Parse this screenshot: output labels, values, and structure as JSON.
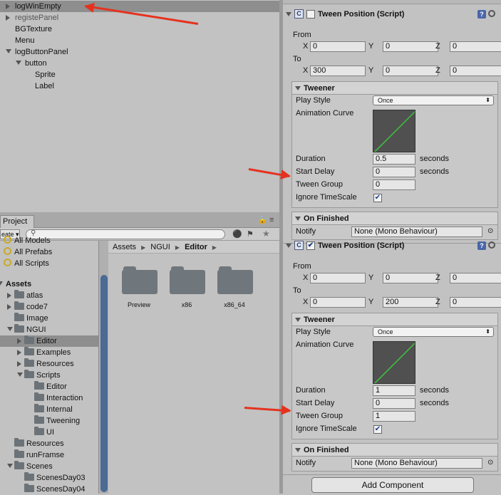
{
  "hierarchy": {
    "items": [
      {
        "label": "logWinEmpty",
        "indent": 1,
        "expander": "right",
        "selected": true
      },
      {
        "label": "registePanel",
        "indent": 1,
        "expander": "right",
        "selected": false,
        "dim": true
      },
      {
        "label": "BGTexture",
        "indent": 1,
        "expander": "none",
        "selected": false
      },
      {
        "label": "Menu",
        "indent": 1,
        "expander": "none",
        "selected": false
      },
      {
        "label": "logButtonPanel",
        "indent": 1,
        "expander": "down",
        "selected": false
      },
      {
        "label": "button",
        "indent": 2,
        "expander": "down",
        "selected": false
      },
      {
        "label": "Sprite",
        "indent": 3,
        "expander": "none",
        "selected": false
      },
      {
        "label": "Label",
        "indent": 3,
        "expander": "none",
        "selected": false
      }
    ]
  },
  "project": {
    "tab_label": "Project",
    "create_label": "eate",
    "favorites": [
      "All Models",
      "All Prefabs",
      "All Scripts"
    ],
    "tree": [
      {
        "label": "Assets",
        "indent": 0,
        "bold": true,
        "expander": "down",
        "folder": false
      },
      {
        "label": "atlas",
        "indent": 1,
        "expander": "right",
        "folder": true
      },
      {
        "label": "code7",
        "indent": 1,
        "expander": "right",
        "folder": true
      },
      {
        "label": "Image",
        "indent": 1,
        "expander": "none",
        "folder": true
      },
      {
        "label": "NGUI",
        "indent": 1,
        "expander": "down",
        "folder": true
      },
      {
        "label": "Editor",
        "indent": 2,
        "expander": "right",
        "folder": true,
        "selected": true
      },
      {
        "label": "Examples",
        "indent": 2,
        "expander": "right",
        "folder": true
      },
      {
        "label": "Resources",
        "indent": 2,
        "expander": "right",
        "folder": true
      },
      {
        "label": "Scripts",
        "indent": 2,
        "expander": "down",
        "folder": true
      },
      {
        "label": "Editor",
        "indent": 3,
        "expander": "none",
        "folder": true
      },
      {
        "label": "Interaction",
        "indent": 3,
        "expander": "none",
        "folder": true
      },
      {
        "label": "Internal",
        "indent": 3,
        "expander": "none",
        "folder": true
      },
      {
        "label": "Tweening",
        "indent": 3,
        "expander": "none",
        "folder": true
      },
      {
        "label": "UI",
        "indent": 3,
        "expander": "none",
        "folder": true
      },
      {
        "label": "Resources",
        "indent": 1,
        "expander": "none",
        "folder": true
      },
      {
        "label": "runFramse",
        "indent": 1,
        "expander": "none",
        "folder": true
      },
      {
        "label": "Scenes",
        "indent": 1,
        "expander": "down",
        "folder": true
      },
      {
        "label": "ScenesDay03",
        "indent": 2,
        "expander": "none",
        "folder": true
      },
      {
        "label": "ScenesDay04",
        "indent": 2,
        "expander": "none",
        "folder": true
      }
    ],
    "breadcrumb": [
      "Assets",
      "NGUI",
      "Editor"
    ],
    "folders": [
      "Preview",
      "x86",
      "x86_64"
    ]
  },
  "inspector": {
    "components": [
      {
        "title": "Tween Position (Script)",
        "enabled": false,
        "from_label": "From",
        "to_label": "To",
        "from": {
          "x": "0",
          "y": "0",
          "z": "0"
        },
        "to": {
          "x": "300",
          "y": "0",
          "z": "0"
        },
        "tweener_label": "Tweener",
        "play_style_label": "Play Style",
        "play_style": "Once",
        "curve_label": "Animation Curve",
        "duration_label": "Duration",
        "duration": "0.5",
        "start_delay_label": "Start Delay",
        "start_delay": "0",
        "seconds": "seconds",
        "tween_group_label": "Tween Group",
        "tween_group": "0",
        "ignore_ts_label": "Ignore TimeScale",
        "ignore_ts": true,
        "on_finished_label": "On Finished",
        "notify_label": "Notify",
        "notify": "None (Mono Behaviour)"
      },
      {
        "title": "Tween Position (Script)",
        "enabled": true,
        "from_label": "From",
        "to_label": "To",
        "from": {
          "x": "0",
          "y": "0",
          "z": "0"
        },
        "to": {
          "x": "0",
          "y": "200",
          "z": "0"
        },
        "tweener_label": "Tweener",
        "play_style_label": "Play Style",
        "play_style": "Once",
        "curve_label": "Animation Curve",
        "duration_label": "Duration",
        "duration": "1",
        "start_delay_label": "Start Delay",
        "start_delay": "0",
        "seconds": "seconds",
        "tween_group_label": "Tween Group",
        "tween_group": "1",
        "ignore_ts_label": "Ignore TimeScale",
        "ignore_ts": true,
        "on_finished_label": "On Finished",
        "notify_label": "Notify",
        "notify": "None (Mono Behaviour)"
      }
    ],
    "axis": {
      "x": "X",
      "y": "Y",
      "z": "Z"
    },
    "add_component_label": "Add Component"
  },
  "colors": {
    "annotation_arrow": "#e5321f",
    "selection": "#8e8e8e",
    "folder": "#6f767c",
    "scroll_thumb": "#4b6a94"
  }
}
